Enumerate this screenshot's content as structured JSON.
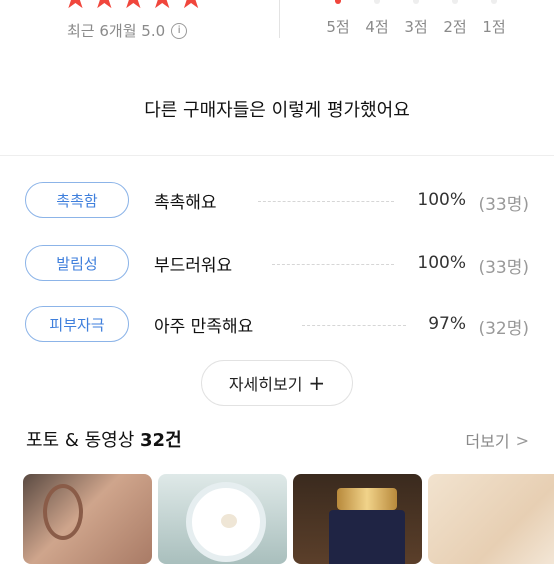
{
  "rating": {
    "stars": 5,
    "recent_label": "최근 6개월 5.0",
    "distribution": [
      {
        "label": "5점",
        "fraction": 1.0
      },
      {
        "label": "4점",
        "fraction": 0.0
      },
      {
        "label": "3점",
        "fraction": 0.0
      },
      {
        "label": "2점",
        "fraction": 0.0
      },
      {
        "label": "1점",
        "fraction": 0.0
      }
    ]
  },
  "evaluation": {
    "title": "다른 구매자들은 이렇게 평가했어요",
    "rows": [
      {
        "tag": "촉촉함",
        "text": "촉촉해요",
        "percent": "100%",
        "count": "(33명)"
      },
      {
        "tag": "발림성",
        "text": "부드러워요",
        "percent": "100%",
        "count": "(33명)"
      },
      {
        "tag": "피부자극",
        "text": "아주 만족해요",
        "percent": "97%",
        "count": "(32명)"
      }
    ],
    "more_button": "자세히보기"
  },
  "photos": {
    "title_prefix": "포토 & 동영상",
    "title_count": "32건",
    "see_more": "더보기"
  },
  "colors": {
    "accent": "#f0463c",
    "tag_blue": "#3f7fdc"
  }
}
